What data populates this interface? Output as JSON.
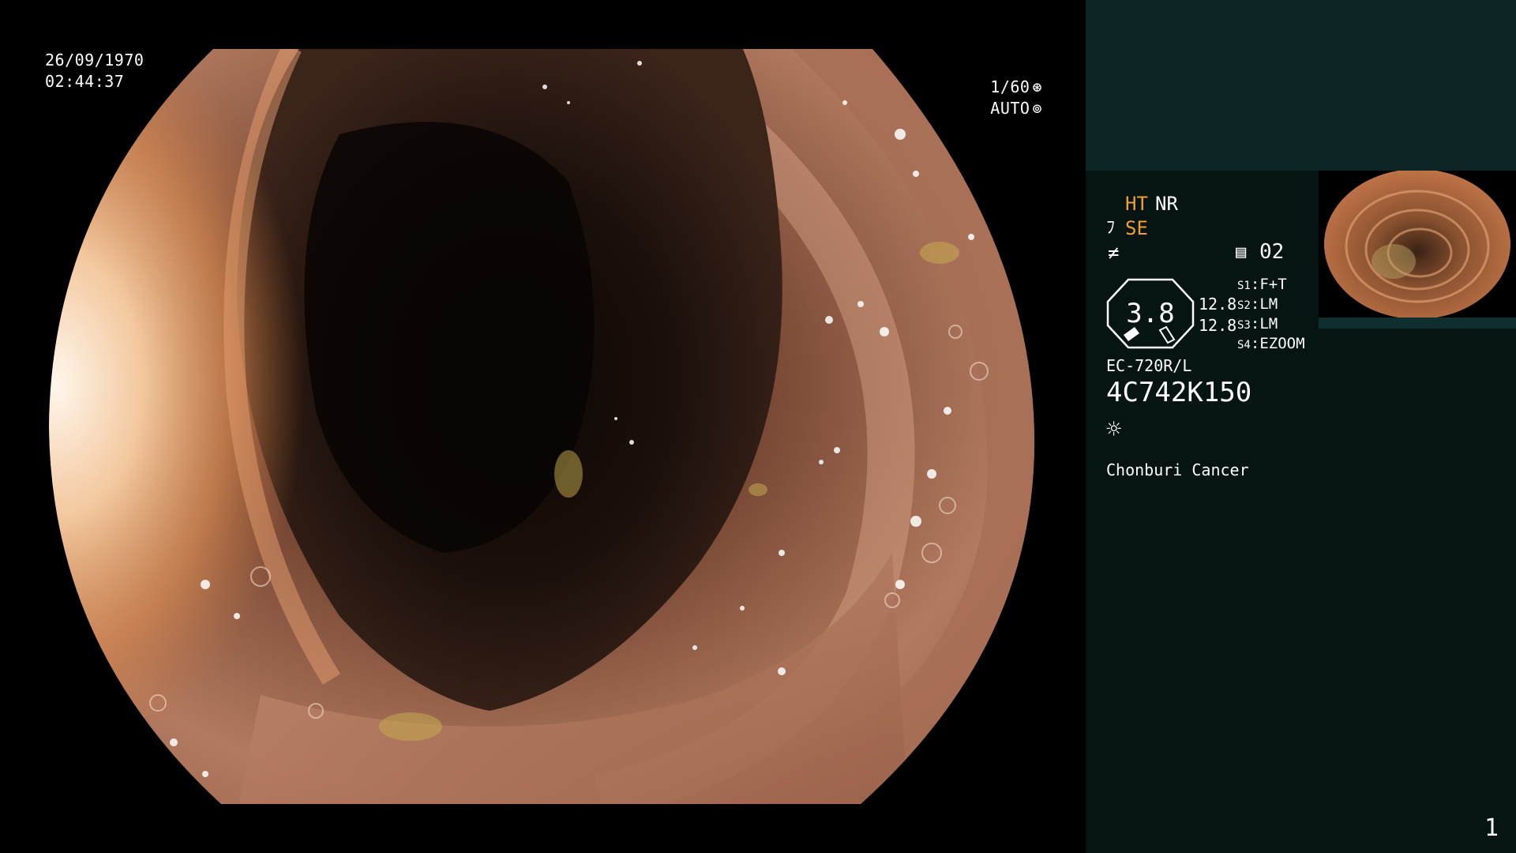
{
  "overlay": {
    "date": "26/09/1970",
    "time": "02:44:37",
    "shutter": "1/60",
    "shutter_icon": "shutter-icon",
    "iris": "AUTO",
    "iris_icon": "iris-icon"
  },
  "panel": {
    "ht": "HT",
    "nr": "NR",
    "se": "SE",
    "enhance_icon": "enhancement-icon",
    "memory_icon": "document-icon",
    "channel": "02",
    "zoom_value": "3.8",
    "value_1": "12.8",
    "value_2": "12.8",
    "switches": [
      {
        "key": "S1",
        "value": "F+T"
      },
      {
        "key": "S2",
        "value": "LM"
      },
      {
        "key": "S3",
        "value": "LM"
      },
      {
        "key": "S4",
        "value": "EZOOM"
      }
    ],
    "scope_model": "EC-720R/L",
    "serial": "4C742K150",
    "light_icon": "sun-icon",
    "facility": "Chonburi Cancer",
    "page": "1"
  },
  "colors": {
    "amber": "#f0a030",
    "panel_bg": "#061414",
    "panel_top_bg": "#0c2525"
  }
}
